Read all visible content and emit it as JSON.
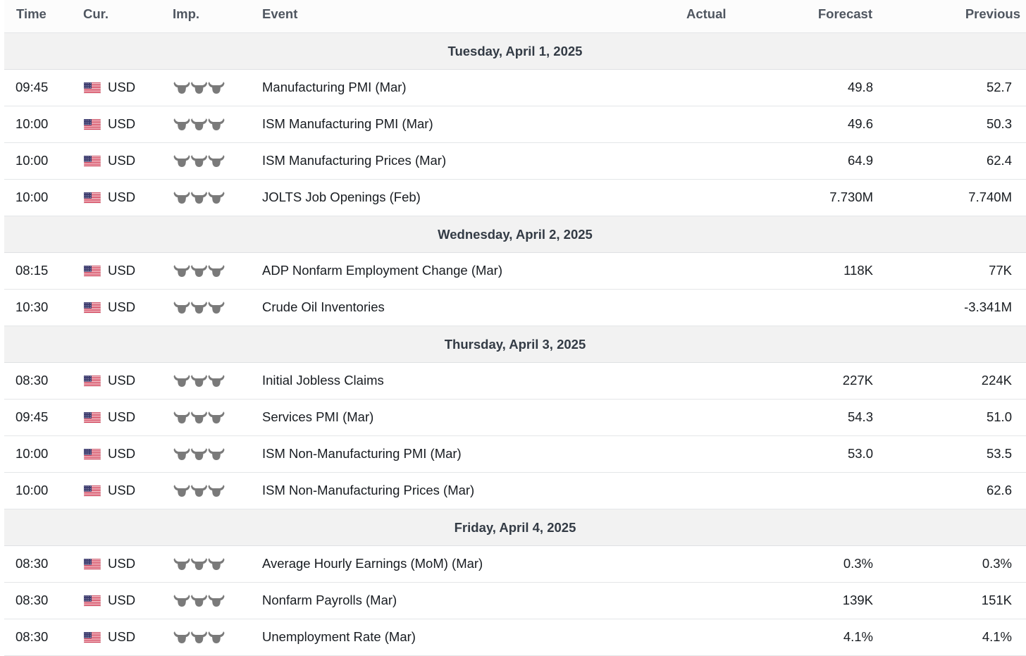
{
  "header": {
    "time": "Time",
    "currency": "Cur.",
    "importance": "Imp.",
    "event": "Event",
    "actual": "Actual",
    "forecast": "Forecast",
    "previous": "Previous"
  },
  "days": [
    {
      "date": "Tuesday, April 1, 2025",
      "events": [
        {
          "time": "09:45",
          "currency": "USD",
          "event": "Manufacturing PMI (Mar)",
          "actual": "",
          "forecast": "49.8",
          "previous": "52.7"
        },
        {
          "time": "10:00",
          "currency": "USD",
          "event": "ISM Manufacturing PMI (Mar)",
          "actual": "",
          "forecast": "49.6",
          "previous": "50.3"
        },
        {
          "time": "10:00",
          "currency": "USD",
          "event": "ISM Manufacturing Prices (Mar)",
          "actual": "",
          "forecast": "64.9",
          "previous": "62.4"
        },
        {
          "time": "10:00",
          "currency": "USD",
          "event": "JOLTS Job Openings (Feb)",
          "actual": "",
          "forecast": "7.730M",
          "previous": "7.740M"
        }
      ]
    },
    {
      "date": "Wednesday, April 2, 2025",
      "events": [
        {
          "time": "08:15",
          "currency": "USD",
          "event": "ADP Nonfarm Employment Change (Mar)",
          "actual": "",
          "forecast": "118K",
          "previous": "77K"
        },
        {
          "time": "10:30",
          "currency": "USD",
          "event": "Crude Oil Inventories",
          "actual": "",
          "forecast": "",
          "previous": "-3.341M"
        }
      ]
    },
    {
      "date": "Thursday, April 3, 2025",
      "events": [
        {
          "time": "08:30",
          "currency": "USD",
          "event": "Initial Jobless Claims",
          "actual": "",
          "forecast": "227K",
          "previous": "224K"
        },
        {
          "time": "09:45",
          "currency": "USD",
          "event": "Services PMI (Mar)",
          "actual": "",
          "forecast": "54.3",
          "previous": "51.0"
        },
        {
          "time": "10:00",
          "currency": "USD",
          "event": "ISM Non-Manufacturing PMI (Mar)",
          "actual": "",
          "forecast": "53.0",
          "previous": "53.5"
        },
        {
          "time": "10:00",
          "currency": "USD",
          "event": "ISM Non-Manufacturing Prices (Mar)",
          "actual": "",
          "forecast": "",
          "previous": "62.6"
        }
      ]
    },
    {
      "date": "Friday, April 4, 2025",
      "events": [
        {
          "time": "08:30",
          "currency": "USD",
          "event": "Average Hourly Earnings (MoM) (Mar)",
          "actual": "",
          "forecast": "0.3%",
          "previous": "0.3%"
        },
        {
          "time": "08:30",
          "currency": "USD",
          "event": "Nonfarm Payrolls (Mar)",
          "actual": "",
          "forecast": "139K",
          "previous": "151K"
        },
        {
          "time": "08:30",
          "currency": "USD",
          "event": "Unemployment Rate (Mar)",
          "actual": "",
          "forecast": "4.1%",
          "previous": "4.1%"
        }
      ]
    }
  ],
  "icons": {
    "currency_flag": "us-flag-icon",
    "importance": "bull-icon"
  },
  "importance_level": 3,
  "colors": {
    "text": "#181c21",
    "header_text": "#4f5660",
    "date_row_bg": "#f2f2f2",
    "bull_icon": "#7a7a7a",
    "row_border": "#e4e6e8"
  }
}
